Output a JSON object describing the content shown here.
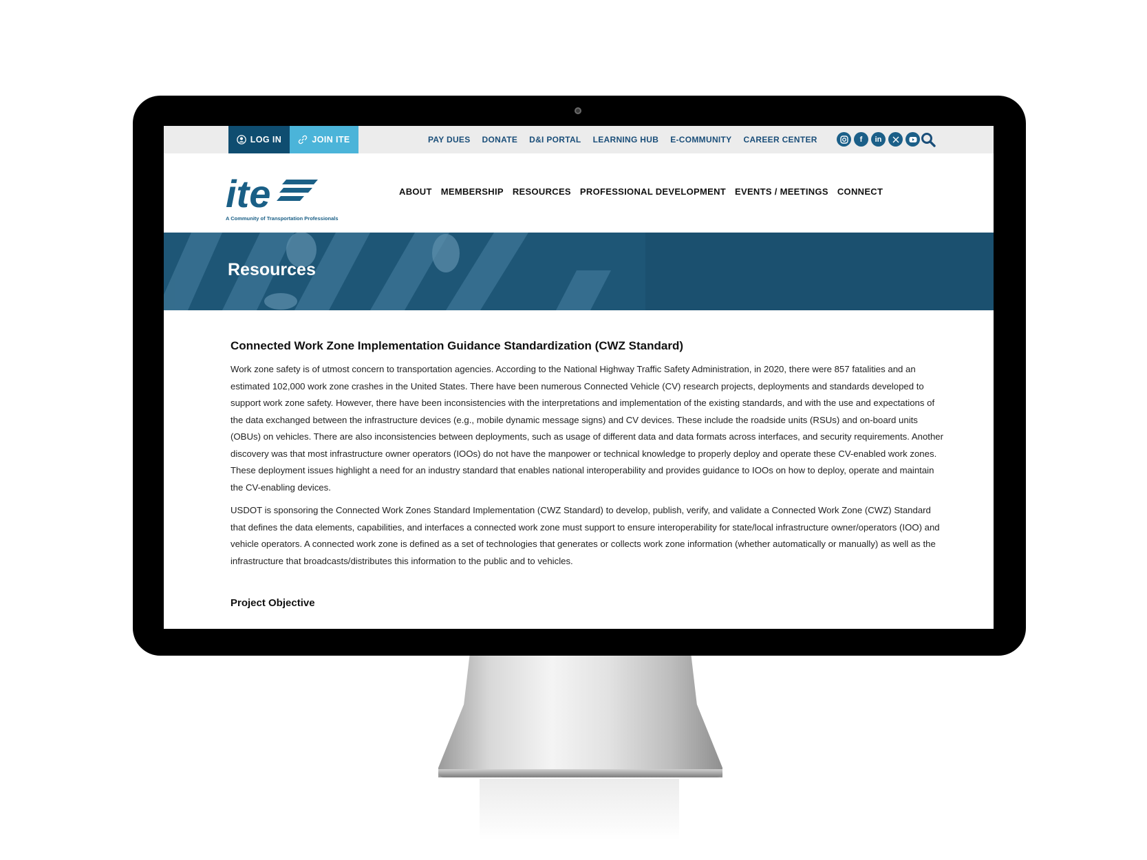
{
  "topbar": {
    "login_label": "LOG IN",
    "join_label": "JOIN ITE",
    "links": [
      "PAY DUES",
      "DONATE",
      "D&I PORTAL",
      "LEARNING HUB",
      "E-COMMUNITY",
      "CAREER CENTER"
    ],
    "social_icons": [
      "instagram-icon",
      "facebook-icon",
      "linkedin-icon",
      "x-icon",
      "youtube-icon"
    ],
    "colors": {
      "login_bg": "#0f4d70",
      "join_bg": "#4bb4d9",
      "link": "#1a4e79"
    }
  },
  "header": {
    "logo_text": "ite",
    "logo_tagline": "A Community of Transportation Professionals",
    "nav": [
      "ABOUT",
      "MEMBERSHIP",
      "RESOURCES",
      "PROFESSIONAL DEVELOPMENT",
      "EVENTS / MEETINGS",
      "CONNECT"
    ]
  },
  "hero": {
    "title": "Resources",
    "color": "#1e5676"
  },
  "article": {
    "title": "Connected Work Zone Implementation Guidance Standardization (CWZ Standard)",
    "paragraph_1": "Work zone safety is of utmost concern to transportation agencies. According to the National Highway Traffic Safety Administration, in 2020, there were 857 fatalities and an estimated 102,000 work zone crashes in the United States. There have been numerous Connected Vehicle (CV) research projects, deployments and standards developed to support work zone safety. However, there have been inconsistencies with the interpretations and implementation of the existing standards, and with the use and expectations of the data exchanged between the infrastructure devices (e.g., mobile dynamic message signs) and CV devices. These include  the roadside units (RSUs) and on-board units (OBUs) on vehicles.  There are also inconsistencies between deployments, such as usage of different data and data formats across interfaces, and security requirements.  Another discovery was that most infrastructure owner operators (IOOs) do not have the manpower or technical knowledge to properly deploy and operate these CV-enabled work zones. These deployment issues highlight a need for an industry standard that enables national interoperability and provides guidance to IOOs on how to deploy, operate and maintain the CV-enabling devices.",
    "paragraph_2": "USDOT is sponsoring the Connected Work Zones Standard Implementation (CWZ Standard) to develop, publish, verify, and validate a Connected Work Zone (CWZ) Standard that defines the data elements, capabilities, and interfaces a connected work zone must support to ensure interoperability for state/local infrastructure owner/operators (IOO) and vehicle operators. A connected work zone is defined as a set of technologies that generates or collects work zone information (whether automatically or manually) as well as the infrastructure that broadcasts/distributes this information to the public and to vehicles.",
    "objective_heading": "Project Objective"
  }
}
